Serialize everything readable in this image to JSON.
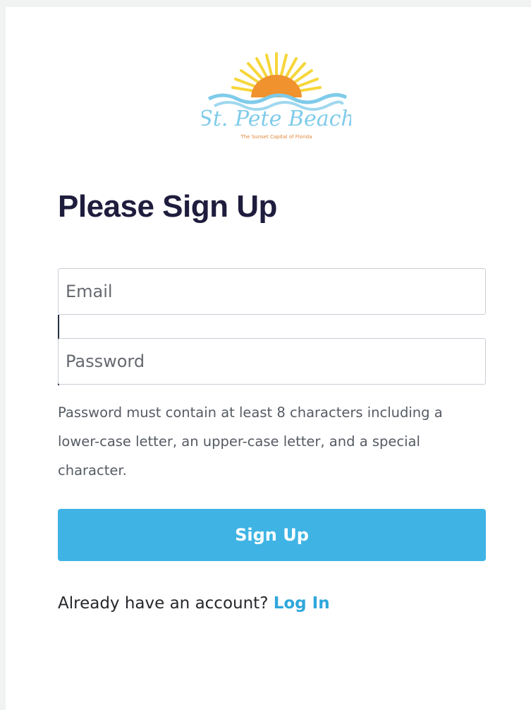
{
  "logo": {
    "brand_text": "St. Pete Beach",
    "tagline": "The Sunset Capital of Florida"
  },
  "form": {
    "title": "Please Sign Up",
    "email_placeholder": "Email",
    "password_placeholder": "Password",
    "password_hint": "Password must contain at least 8 characters including a lower-case letter, an upper-case letter, and a special character.",
    "submit_label": "Sign Up"
  },
  "footer": {
    "prompt": "Already have an account?",
    "login_label": "Log In"
  },
  "colors": {
    "accent": "#3fb4e4",
    "link": "#2ea7dc",
    "title": "#1f1d3d",
    "sun": "#f0922e",
    "rays": "#f6d63a",
    "waves": "#7fcbea"
  },
  "icons": {
    "logo": "sun-over-waves-logo"
  }
}
